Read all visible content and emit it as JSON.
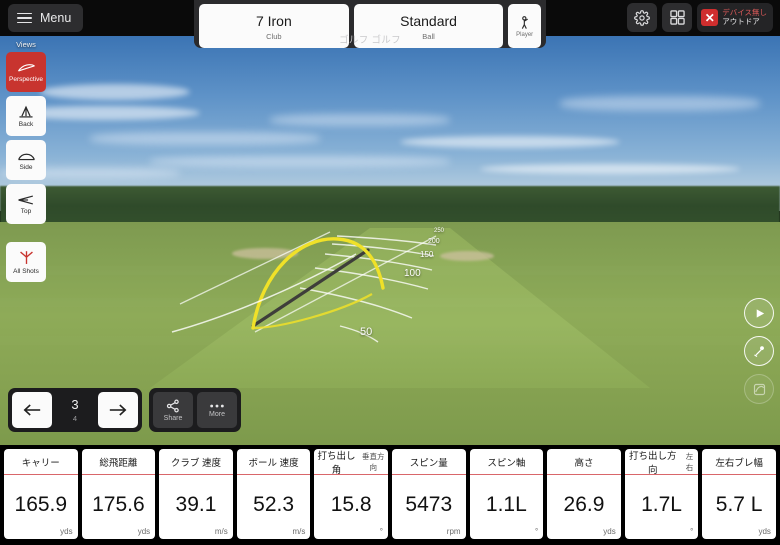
{
  "topbar": {
    "menu_label": "Menu",
    "menu_icon": "hamburger-icon",
    "club": {
      "value": "7 Iron",
      "label": "Club"
    },
    "ball": {
      "value": "Standard",
      "label": "Ball"
    },
    "player": {
      "label": "Player",
      "icon": "player-icon"
    },
    "course_name": "ゴルフ ゴルフ",
    "settings_icon": "gear-icon",
    "grid_icon": "grid-icon",
    "device_status": {
      "icon": "close-x-icon",
      "line1": "デバイス無し",
      "line2": "アウトドア"
    }
  },
  "views": {
    "title": "Views",
    "items": [
      {
        "label": "Perspective",
        "icon": "perspective-icon",
        "active": true
      },
      {
        "label": "Back",
        "icon": "back-view-icon",
        "active": false
      },
      {
        "label": "Side",
        "icon": "side-view-icon",
        "active": false
      },
      {
        "label": "Top",
        "icon": "top-view-icon",
        "active": false
      }
    ],
    "all_shots": {
      "label": "All Shots",
      "icon": "all-shots-icon"
    }
  },
  "scene": {
    "distance_markers": [
      "50",
      "100",
      "150",
      "200",
      "250"
    ],
    "trajectory_color": "#f0e128",
    "reference_line_color": "#3e3e3a",
    "sky_color": "#5f93c8",
    "ground_color": "#8eab58"
  },
  "playback": {
    "play_icon": "play-icon",
    "swing_icon": "club-swing-icon",
    "flight_icon": "ball-flight-icon"
  },
  "shot_nav": {
    "prev_icon": "arrow-left-icon",
    "next_icon": "arrow-right-icon",
    "current": "3",
    "total": "4",
    "share": {
      "label": "Share",
      "icon": "share-icon"
    },
    "more": {
      "label": "More",
      "icon": "more-dots-icon"
    }
  },
  "stats": {
    "accent_color": "#d9666a",
    "items": [
      {
        "label": "キャリー",
        "sub": "",
        "value": "165.9",
        "unit": "yds"
      },
      {
        "label": "総飛距離",
        "sub": "",
        "value": "175.6",
        "unit": "yds"
      },
      {
        "label": "クラブ 速度",
        "sub": "",
        "value": "39.1",
        "unit": "m/s"
      },
      {
        "label": "ボール 速度",
        "sub": "",
        "value": "52.3",
        "unit": "m/s"
      },
      {
        "label": "打ち出し角",
        "sub": "垂直方向",
        "value": "15.8",
        "unit": "°"
      },
      {
        "label": "スピン量",
        "sub": "",
        "value": "5473",
        "unit": "rpm"
      },
      {
        "label": "スピン軸",
        "sub": "",
        "value": "1.1L",
        "unit": "°"
      },
      {
        "label": "高さ",
        "sub": "",
        "value": "26.9",
        "unit": "yds"
      },
      {
        "label": "打ち出し方向",
        "sub": "左右",
        "value": "1.7L",
        "unit": "°"
      },
      {
        "label": "左右ブレ幅",
        "sub": "",
        "value": "5.7 L",
        "unit": "yds"
      }
    ]
  }
}
